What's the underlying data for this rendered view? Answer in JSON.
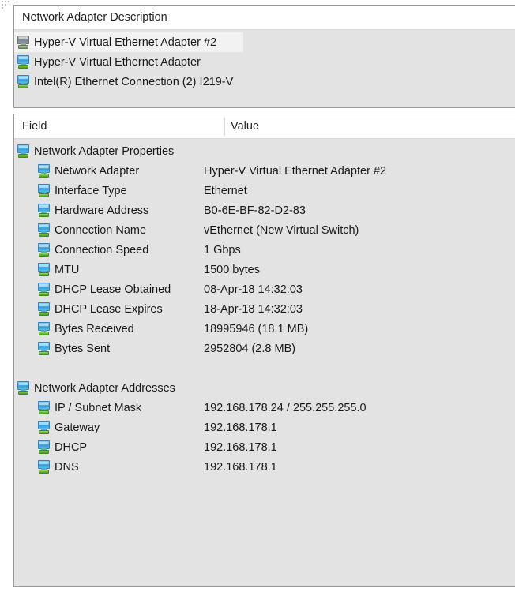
{
  "adapter_panel": {
    "header": "Network Adapter Description",
    "icon": "network-adapter-icon",
    "items": [
      {
        "label": "Hyper-V Virtual Ethernet Adapter #2",
        "selected": true
      },
      {
        "label": "Hyper-V Virtual Ethernet Adapter",
        "selected": false
      },
      {
        "label": "Intel(R) Ethernet Connection (2) I219-V",
        "selected": false
      }
    ]
  },
  "detail_panel": {
    "columns": {
      "field": "Field",
      "value": "Value"
    },
    "rows": [
      {
        "type": "group",
        "field": "Network Adapter Properties",
        "value": ""
      },
      {
        "type": "child",
        "field": "Network Adapter",
        "value": "Hyper-V Virtual Ethernet Adapter #2"
      },
      {
        "type": "child",
        "field": "Interface Type",
        "value": "Ethernet"
      },
      {
        "type": "child",
        "field": "Hardware Address",
        "value": "B0-6E-BF-82-D2-83"
      },
      {
        "type": "child",
        "field": "Connection Name",
        "value": "vEthernet (New Virtual Switch)"
      },
      {
        "type": "child",
        "field": "Connection Speed",
        "value": "1 Gbps"
      },
      {
        "type": "child",
        "field": "MTU",
        "value": "1500 bytes"
      },
      {
        "type": "child",
        "field": "DHCP Lease Obtained",
        "value": "08-Apr-18 14:32:03"
      },
      {
        "type": "child",
        "field": "DHCP Lease Expires",
        "value": "18-Apr-18 14:32:03"
      },
      {
        "type": "child",
        "field": "Bytes Received",
        "value": "18995946 (18.1 MB)"
      },
      {
        "type": "child",
        "field": "Bytes Sent",
        "value": "2952804 (2.8 MB)"
      },
      {
        "type": "spacer",
        "field": "",
        "value": ""
      },
      {
        "type": "group",
        "field": "Network Adapter Addresses",
        "value": ""
      },
      {
        "type": "child",
        "field": "IP / Subnet Mask",
        "value": "192.168.178.24 / 255.255.255.0"
      },
      {
        "type": "child",
        "field": "Gateway",
        "value": "192.168.178.1"
      },
      {
        "type": "child",
        "field": "DHCP",
        "value": "192.168.178.1"
      },
      {
        "type": "child",
        "field": "DNS",
        "value": "192.168.178.1"
      }
    ]
  },
  "colors": {
    "panel_background": "#e3e3e3",
    "header_background": "#ffffff",
    "panel_border": "#9a9a9a",
    "selection_highlight": "#f2f2f2",
    "icon_blue": "#4fb3e8",
    "icon_green": "#5fb52c",
    "text": "#1a1a1a"
  }
}
